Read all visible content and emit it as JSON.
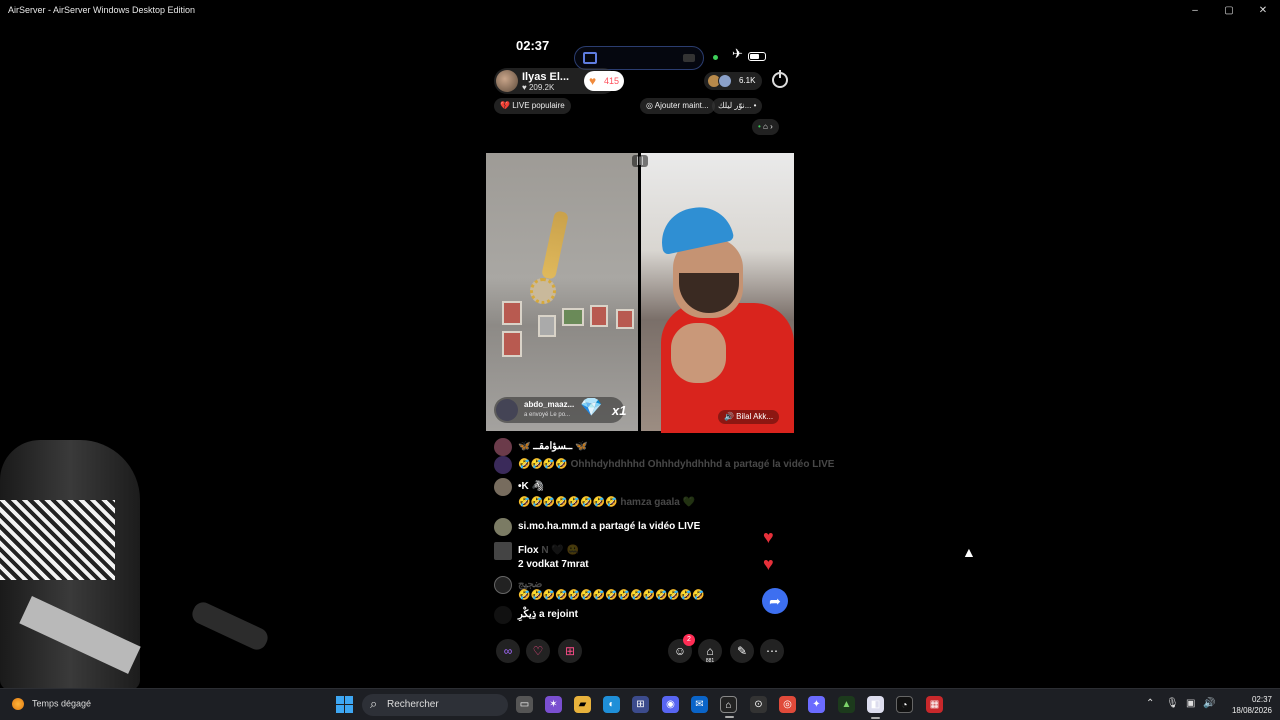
{
  "window": {
    "title": "AirServer - AirServer Windows Desktop Edition",
    "minimize": "–",
    "maximize": "▢",
    "close": "✕"
  },
  "status_bar": {
    "time": "02:37",
    "island_label": "×"
  },
  "host": {
    "name": "Ilyas El...",
    "likes": "209.2K",
    "like_glyph": "♥",
    "gift_count": "415",
    "gift_glyph": "♥"
  },
  "viewers": {
    "count": "6.1K"
  },
  "pills": {
    "popular": "LIVE populaire",
    "popular_icon": "💔",
    "add": "Ajouter maint...",
    "add_icon": "◎",
    "arabic_btn": "نوّر ليلك...",
    "arabic_dot": "•",
    "explore": "⌂",
    "explore_dot": "•",
    "explore_arrow": "›"
  },
  "video": {
    "divider_icon": "|||",
    "gift": {
      "sender": "abdo_maaz...",
      "text": "a envoyé   Le po...",
      "gem": "💎",
      "multiplier": "x1"
    },
    "guest": {
      "name": "🔊 Bilal Akk..."
    }
  },
  "chat": [
    {
      "text": "🦋 ــسؤامقــ 🦋",
      "ghost": "",
      "faded": ""
    },
    {
      "text": "🤣🤣🤣🤣",
      "ghost": "Ohhhdyhdhhhd Ohhhdyhdhhhd a partagé la vidéo LIVE",
      "faded": ""
    },
    {
      "text": "•K 🦓",
      "ghost": "",
      "faded": ""
    },
    {
      "text": "🤣🤣🤣🤣🤣🤣🤣🤣",
      "ghost": "hamza gaala 💚",
      "faded": ""
    },
    {
      "text": "si.mo.ha.mm.d a partagé la vidéo LIVE",
      "ghost": "",
      "faded": ""
    },
    {
      "text": "Flox",
      "ghost": "N 🖤 🤐",
      "faded": ""
    },
    {
      "text": "2 vodkat 7mrat",
      "ghost": "",
      "faded": ""
    },
    {
      "text": "🤣🤣🤣🤣🤣🤣🤣🤣🤣🤣🤣🤣🤣🤣🤣",
      "ghost": "ضجيج",
      "faded": ""
    },
    {
      "text": "ذِيكْرِ a rejoint",
      "ghost": "",
      "faded": "a rejoint"
    }
  ],
  "reactions": {
    "heart": "♥",
    "share": "➦"
  },
  "toolbar": {
    "b1": "∞",
    "b2": "♡",
    "b3": "⊞",
    "b4": "☺",
    "b4_badge": "2",
    "b5": "⌂",
    "b5_sub": "881",
    "b6": "✎",
    "b7": "⋯"
  },
  "taskbar": {
    "weather": "Temps dégagé",
    "search_placeholder": "Rechercher",
    "apps": [
      "▭",
      "✶",
      "▰",
      "◐",
      "⊞",
      "◉",
      "✉",
      "⌂",
      "⊙",
      "◎",
      "✦",
      "▲",
      "◧",
      "◔",
      "▦"
    ],
    "tray": {
      "chevron": "⌃",
      "mic": "🎙",
      "net": "▣",
      "vol": "🔊"
    },
    "time": "02:37",
    "date": "18/08/2026"
  },
  "cursor": "▲"
}
